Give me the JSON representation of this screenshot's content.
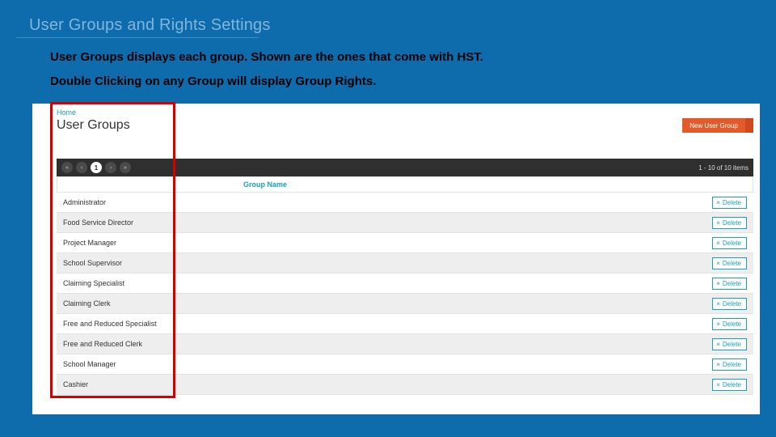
{
  "slide": {
    "title": "User Groups and Rights Settings",
    "caption1": "User Groups displays each group. Shown are the ones that come with HST.",
    "caption2": "Double Clicking on any  Group will display Group Rights."
  },
  "app": {
    "breadcrumb": "Home",
    "heading": "User Groups",
    "new_button": "New User Group",
    "pager": {
      "first": "«",
      "prev": "‹",
      "current": "1",
      "next": "›",
      "last": "»",
      "info": "1 - 10 of 10 items"
    },
    "column_header": "Group Name",
    "delete_label": "Delete",
    "delete_x": "×",
    "groups": [
      {
        "name": "Administrator"
      },
      {
        "name": "Food Service Director"
      },
      {
        "name": "Project Manager"
      },
      {
        "name": "School Supervisor"
      },
      {
        "name": "Claiming Specialist"
      },
      {
        "name": "Claiming Clerk"
      },
      {
        "name": "Free and Reduced Specialist"
      },
      {
        "name": "Free and Reduced Clerk"
      },
      {
        "name": "School Manager"
      },
      {
        "name": "Cashier"
      }
    ]
  }
}
